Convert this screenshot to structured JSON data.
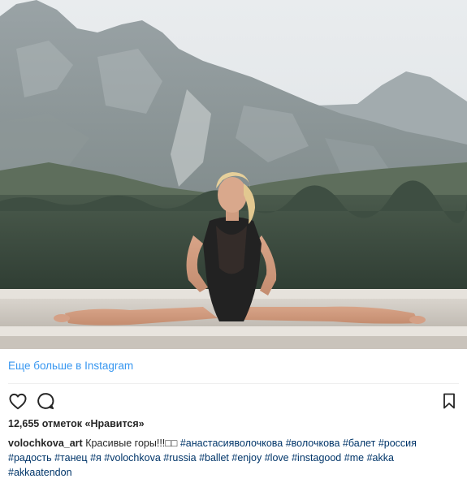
{
  "embed": {
    "more_link": "Еще больше в Instagram"
  },
  "post": {
    "image_subject": "ballerina doing a split on a ledge in front of mountains",
    "likes_text": "12,655 отметок «Нравится»",
    "caption": {
      "username": "volochkova_art",
      "text": "Красивые горы!!!□□",
      "hashtags": [
        "#анастасияволочкова",
        "#волочкова",
        "#балет",
        "#россия",
        "#радость",
        "#танец",
        "#я",
        "#volochkova",
        "#russia",
        "#ballet",
        "#enjoy",
        "#love",
        "#instagood",
        "#me",
        "#akka",
        "#akkaatendon"
      ]
    }
  },
  "actions": {
    "like_icon": "heart-icon",
    "comment_icon": "comment-icon",
    "save_icon": "bookmark-icon"
  },
  "colors": {
    "link": "#3897f0",
    "hashtag": "#003569",
    "text": "#262626",
    "divider": "#efefef"
  }
}
